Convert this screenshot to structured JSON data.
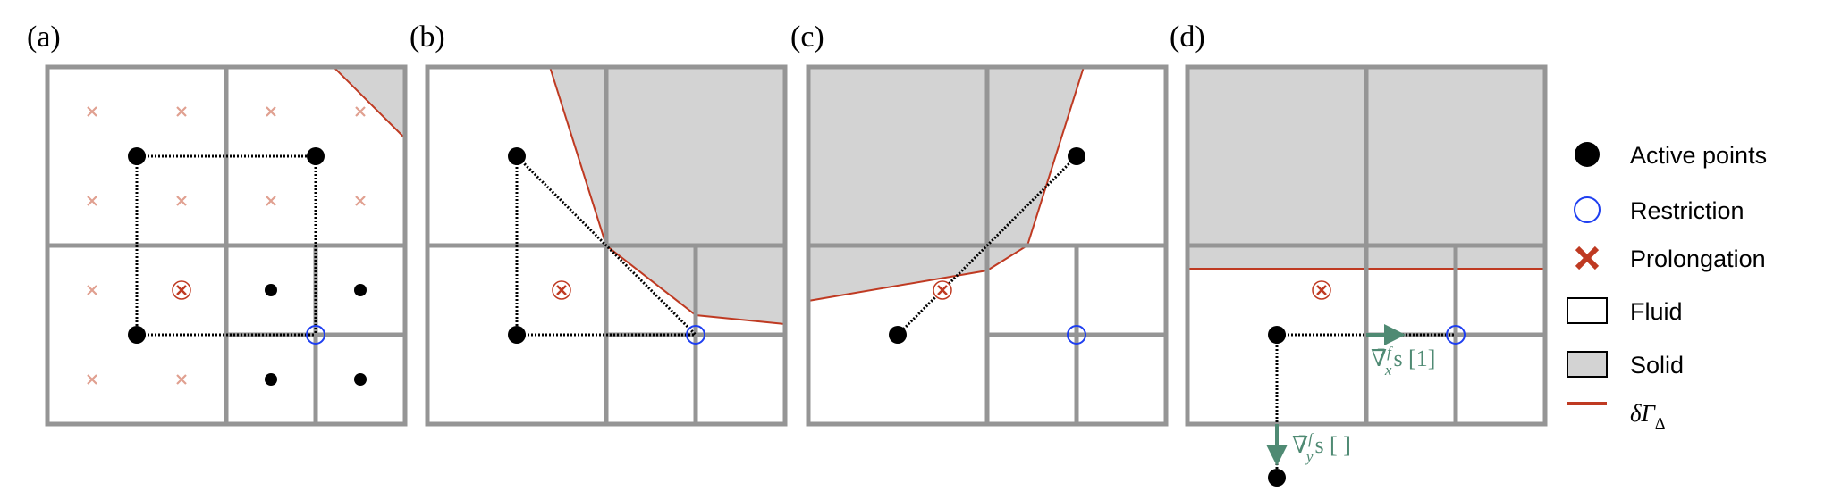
{
  "figure": {
    "panels": [
      {
        "label": "(a)",
        "solid_polygon": [
          [
            320,
            0
          ],
          [
            400,
            0
          ],
          [
            400,
            80
          ]
        ],
        "boundary": [
          [
            320,
            0
          ],
          [
            400,
            80
          ]
        ],
        "refined_coarse_cells": [
          [
            1,
            1
          ]
        ],
        "small_prolongation_marks": [
          [
            50,
            50
          ],
          [
            150,
            50
          ],
          [
            250,
            50
          ],
          [
            350,
            50
          ],
          [
            50,
            150
          ],
          [
            150,
            150
          ],
          [
            250,
            150
          ],
          [
            350,
            150
          ],
          [
            50,
            250
          ],
          [
            50,
            350
          ],
          [
            150,
            350
          ]
        ],
        "small_active_points": [
          [
            250,
            250
          ],
          [
            350,
            250
          ],
          [
            250,
            350
          ],
          [
            350,
            350
          ]
        ],
        "active_points": [
          [
            100,
            100
          ],
          [
            300,
            100
          ],
          [
            100,
            300
          ]
        ],
        "prolongation_point": [
          150,
          250
        ],
        "restriction_point": [
          300,
          300
        ],
        "dotted_links": [
          [
            [
              100,
              100
            ],
            [
              300,
              100
            ]
          ],
          [
            [
              100,
              100
            ],
            [
              100,
              300
            ]
          ],
          [
            [
              300,
              100
            ],
            [
              300,
              300
            ]
          ],
          [
            [
              100,
              300
            ],
            [
              300,
              300
            ]
          ]
        ]
      },
      {
        "label": "(b)",
        "solid_polygon": [
          [
            137,
            0
          ],
          [
            400,
            0
          ],
          [
            400,
            288
          ],
          [
            300,
            278
          ],
          [
            200,
            200
          ]
        ],
        "boundary": [
          [
            137,
            0
          ],
          [
            200,
            200
          ],
          [
            300,
            278
          ],
          [
            400,
            288
          ]
        ],
        "refined_coarse_cells": [
          [
            1,
            1
          ]
        ],
        "small_prolongation_marks": [],
        "small_active_points": [],
        "active_points": [
          [
            100,
            100
          ],
          [
            100,
            300
          ]
        ],
        "prolongation_point": [
          150,
          250
        ],
        "restriction_point": [
          300,
          300
        ],
        "dotted_links": [
          [
            [
              100,
              100
            ],
            [
              100,
              300
            ]
          ],
          [
            [
              100,
              100
            ],
            [
              300,
              300
            ]
          ],
          [
            [
              100,
              300
            ],
            [
              300,
              300
            ]
          ]
        ]
      },
      {
        "label": "(c)",
        "solid_polygon": [
          [
            0,
            0
          ],
          [
            308,
            0
          ],
          [
            245,
            200
          ],
          [
            200,
            228
          ],
          [
            0,
            262
          ]
        ],
        "boundary": [
          [
            308,
            0
          ],
          [
            245,
            200
          ],
          [
            200,
            228
          ],
          [
            0,
            262
          ]
        ],
        "refined_coarse_cells": [
          [
            1,
            1
          ]
        ],
        "small_prolongation_marks": [],
        "small_active_points": [],
        "active_points": [
          [
            300,
            100
          ],
          [
            100,
            300
          ]
        ],
        "prolongation_point": [
          150,
          250
        ],
        "restriction_point": [
          300,
          300
        ],
        "dotted_links": [
          [
            [
              300,
              100
            ],
            [
              100,
              300
            ]
          ]
        ]
      },
      {
        "label": "(d)",
        "solid_polygon": [
          [
            0,
            0
          ],
          [
            400,
            0
          ],
          [
            400,
            226
          ],
          [
            0,
            226
          ]
        ],
        "boundary": [
          [
            0,
            226
          ],
          [
            400,
            226
          ]
        ],
        "refined_coarse_cells": [
          [
            1,
            1
          ]
        ],
        "small_prolongation_marks": [],
        "small_active_points": [],
        "active_points": [
          [
            100,
            300
          ],
          [
            100,
            460
          ]
        ],
        "prolongation_point": [
          150,
          250
        ],
        "restriction_point": [
          300,
          300
        ],
        "dotted_links": [
          [
            [
              100,
              300
            ],
            [
              300,
              300
            ]
          ],
          [
            [
              100,
              300
            ],
            [
              100,
              460
            ]
          ]
        ],
        "gradient_arrows": [
          {
            "from": [
              200,
              300
            ],
            "to": [
              240,
              300
            ],
            "label": "∇̄",
            "sup": "f",
            "sub": "x",
            "after": "s [1]"
          },
          {
            "from": [
              100,
              400
            ],
            "to": [
              100,
              443
            ],
            "label": "∇̄",
            "sup": "f",
            "sub": "y",
            "after": "s [ ]"
          }
        ]
      }
    ]
  },
  "legend": {
    "items": [
      {
        "symbol": "active-point",
        "label": "Active points"
      },
      {
        "symbol": "restriction",
        "label": "Restriction"
      },
      {
        "symbol": "prolongation",
        "label": "Prolongation"
      },
      {
        "symbol": "fluid",
        "label": "Fluid"
      },
      {
        "symbol": "solid",
        "label": "Solid"
      },
      {
        "symbol": "boundary",
        "label": "δΓ",
        "sub": "Δ"
      }
    ]
  },
  "colors": {
    "grid": "#959595",
    "solid": "#d3d3d3",
    "boundary": "#bf3a22",
    "restriction": "#1f3ff0",
    "prolongation_faint": "#e0a090",
    "prolongation": "#bf3a22",
    "gradient": "#4f8a73"
  }
}
